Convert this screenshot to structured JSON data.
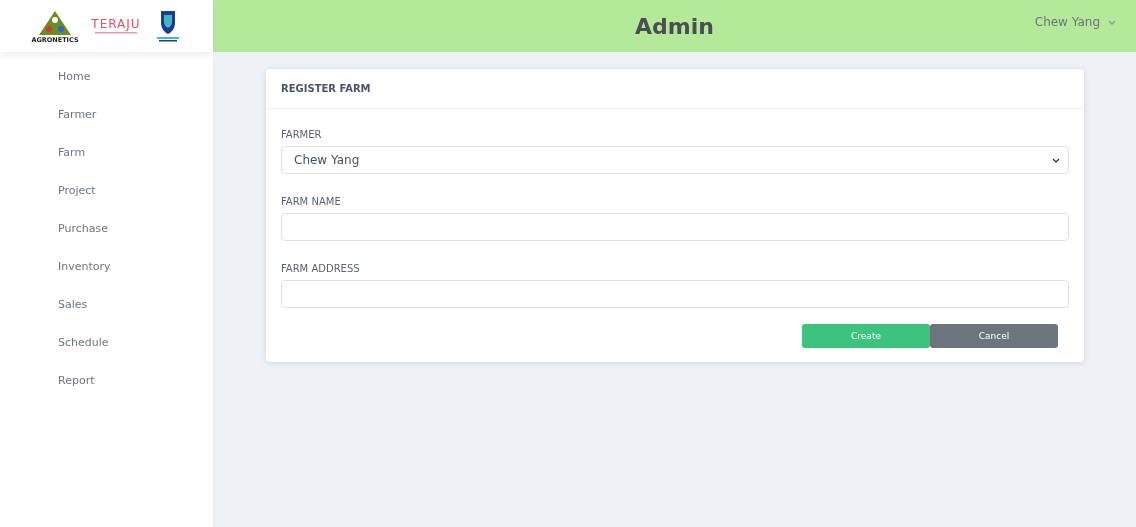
{
  "brand": {
    "logo_1": "AGRONETICS",
    "logo_2": "TERAJU"
  },
  "header": {
    "title": "Admin",
    "user": "Chew Yang"
  },
  "sidebar": {
    "items": [
      {
        "label": "Home"
      },
      {
        "label": "Farmer"
      },
      {
        "label": "Farm"
      },
      {
        "label": "Project"
      },
      {
        "label": "Purchase"
      },
      {
        "label": "Inventory"
      },
      {
        "label": "Sales"
      },
      {
        "label": "Schedule"
      },
      {
        "label": "Report"
      }
    ]
  },
  "form": {
    "title": "REGISTER FARM",
    "fields": [
      {
        "kind": "select",
        "label": "FARMER",
        "value": "Chew Yang"
      },
      {
        "kind": "text",
        "label": "FARM NAME"
      },
      {
        "kind": "text",
        "label": "FARM ADDRESS"
      }
    ],
    "buttons": [
      {
        "kind": "primary",
        "label": "Create"
      },
      {
        "kind": "secondary",
        "label": "Cancel"
      }
    ]
  }
}
